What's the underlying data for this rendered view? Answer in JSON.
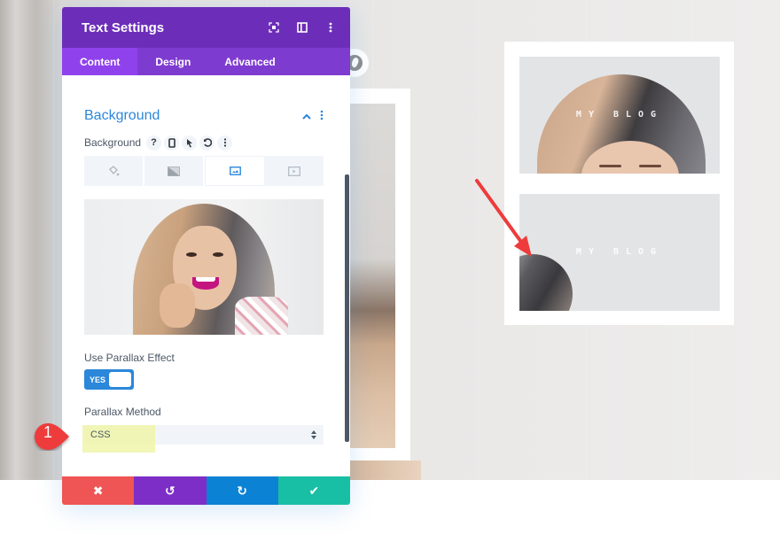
{
  "panel": {
    "title": "Text Settings",
    "header_icons": [
      "focus-icon",
      "split-view-icon",
      "more-vertical-icon"
    ],
    "tabs": [
      {
        "label": "Content",
        "active": true
      },
      {
        "label": "Design",
        "active": false
      },
      {
        "label": "Advanced",
        "active": false
      }
    ],
    "group": {
      "title": "Background",
      "collapse_icon": "chevron-up-icon",
      "menu_icon": "more-vertical-icon"
    },
    "background_field": {
      "label": "Background",
      "help_icon_glyph": "?",
      "icons": [
        "help-icon",
        "mobile-icon",
        "pointer-icon",
        "reset-icon",
        "more-vertical-icon"
      ],
      "type_tabs": [
        {
          "name": "color",
          "icon": "paint-bucket-icon",
          "active": false
        },
        {
          "name": "gradient",
          "icon": "gradient-icon",
          "active": false
        },
        {
          "name": "image",
          "icon": "image-icon",
          "active": true
        },
        {
          "name": "video",
          "icon": "video-icon",
          "active": false
        }
      ]
    },
    "parallax_effect": {
      "label": "Use Parallax Effect",
      "toggle_value": "YES"
    },
    "parallax_method": {
      "label": "Parallax Method",
      "selected": "CSS"
    },
    "footer_buttons": [
      {
        "name": "discard",
        "icon": "close-icon",
        "glyph": "✖",
        "color": "#ef5555"
      },
      {
        "name": "undo",
        "icon": "undo-icon",
        "glyph": "↺",
        "color": "#7d2ec6"
      },
      {
        "name": "redo",
        "icon": "redo-icon",
        "glyph": "↻",
        "color": "#0c82d4"
      },
      {
        "name": "save",
        "icon": "check-icon",
        "glyph": "✔",
        "color": "#18bfa4"
      }
    ]
  },
  "annotation": {
    "step_number": "1"
  },
  "preview_page": {
    "blog_cards": [
      {
        "title": "MY BLOG"
      },
      {
        "title": "MY BLOG"
      }
    ]
  },
  "colors": {
    "header_purple": "#6c2eb9",
    "tab_purple": "#7e3bd0",
    "accent_blue": "#2b87da",
    "annotation_red": "#ee3b3b"
  }
}
